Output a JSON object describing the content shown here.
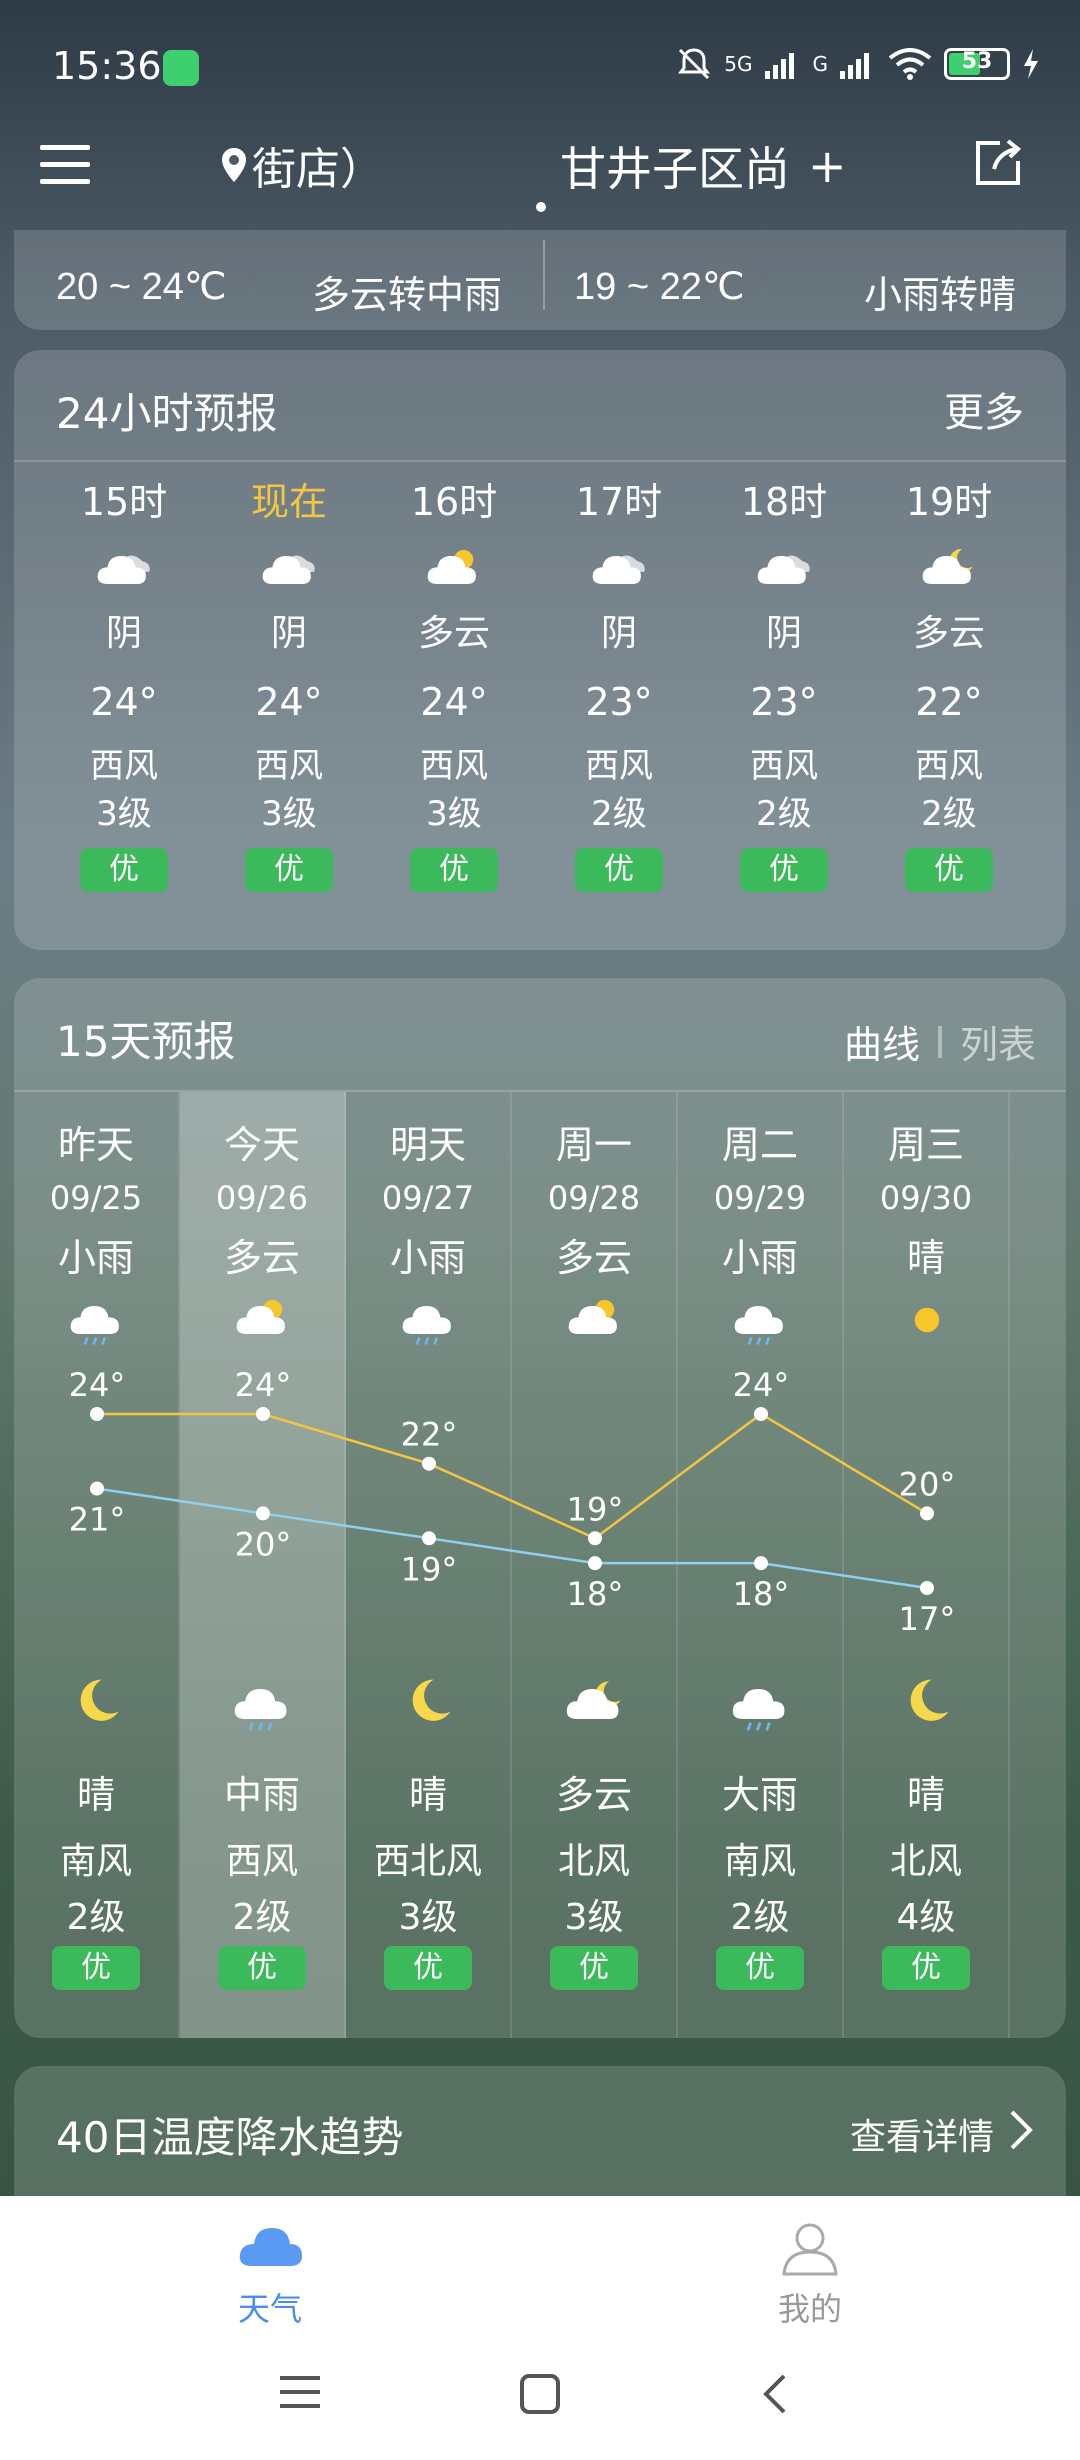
{
  "status_bar": {
    "time": "15:36",
    "network_1": "5G",
    "network_2": "G",
    "battery": "53"
  },
  "header": {
    "location_left": "街店）",
    "location_right": "甘井子区尚",
    "add_label": "+"
  },
  "summary": {
    "today_range": "20 ~ 24℃",
    "today_cond": "多云转中雨",
    "tomorrow_range": "19 ~ 22℃",
    "tomorrow_cond": "小雨转晴"
  },
  "hourly": {
    "title": "24小时预报",
    "more": "更多",
    "items": [
      {
        "time": "15时",
        "cond": "阴",
        "temp": "24°",
        "wind_dir": "西风",
        "wind_lvl": "3级",
        "aqi": "优",
        "icon": "cloudy-icon"
      },
      {
        "time": "现在",
        "cond": "阴",
        "temp": "24°",
        "wind_dir": "西风",
        "wind_lvl": "3级",
        "aqi": "优",
        "icon": "cloudy-icon"
      },
      {
        "time": "16时",
        "cond": "多云",
        "temp": "24°",
        "wind_dir": "西风",
        "wind_lvl": "3级",
        "aqi": "优",
        "icon": "partly-cloudy-icon"
      },
      {
        "time": "17时",
        "cond": "阴",
        "temp": "23°",
        "wind_dir": "西风",
        "wind_lvl": "2级",
        "aqi": "优",
        "icon": "cloudy-icon"
      },
      {
        "time": "18时",
        "cond": "阴",
        "temp": "23°",
        "wind_dir": "西风",
        "wind_lvl": "2级",
        "aqi": "优",
        "icon": "cloudy-icon"
      },
      {
        "time": "19时",
        "cond": "多云",
        "temp": "22°",
        "wind_dir": "西风",
        "wind_lvl": "2级",
        "aqi": "优",
        "icon": "partly-cloudy-night-icon"
      }
    ]
  },
  "daily": {
    "title": "15天预报",
    "mode_curve": "曲线",
    "mode_list": "列表",
    "items": [
      {
        "day": "昨天",
        "date": "09/25",
        "day_cond": "小雨",
        "high": 24,
        "low": 21,
        "night_cond": "晴",
        "wind_dir": "南风",
        "wind_lvl": "2级",
        "aqi": "优"
      },
      {
        "day": "今天",
        "date": "09/26",
        "day_cond": "多云",
        "high": 24,
        "low": 20,
        "night_cond": "中雨",
        "wind_dir": "西风",
        "wind_lvl": "2级",
        "aqi": "优"
      },
      {
        "day": "明天",
        "date": "09/27",
        "day_cond": "小雨",
        "high": 22,
        "low": 19,
        "night_cond": "晴",
        "wind_dir": "西北风",
        "wind_lvl": "3级",
        "aqi": "优"
      },
      {
        "day": "周一",
        "date": "09/28",
        "day_cond": "多云",
        "high": 19,
        "low": 18,
        "night_cond": "多云",
        "wind_dir": "北风",
        "wind_lvl": "3级",
        "aqi": "优"
      },
      {
        "day": "周二",
        "date": "09/29",
        "day_cond": "小雨",
        "high": 24,
        "low": 18,
        "night_cond": "大雨",
        "wind_dir": "南风",
        "wind_lvl": "2级",
        "aqi": "优"
      },
      {
        "day": "周三",
        "date": "09/30",
        "day_cond": "晴",
        "high": 20,
        "low": 17,
        "night_cond": "晴",
        "wind_dir": "北风",
        "wind_lvl": "4级",
        "aqi": "优"
      }
    ]
  },
  "trend": {
    "title": "40日温度降水趋势",
    "link": "查看详情"
  },
  "nav": {
    "weather": "天气",
    "mine": "我的"
  },
  "colors": {
    "high_line": "#f4c542",
    "low_line": "#8fd0ef",
    "aqi_good": "#3cb95a",
    "nav_active": "#4a8cf0"
  }
}
